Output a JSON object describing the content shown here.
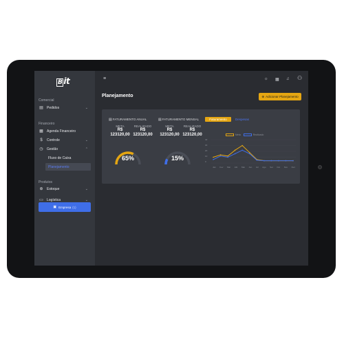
{
  "app": {
    "logo_text": "it",
    "logo_box": "B"
  },
  "sidebar": {
    "sections": [
      {
        "label": "Comercial"
      },
      {
        "label": "Financeiro"
      },
      {
        "label": "Produtos"
      }
    ],
    "items": [
      {
        "label": "Pedidos",
        "icon": "document-icon"
      },
      {
        "label": "Agenda Financeiro",
        "icon": "calendar-icon"
      },
      {
        "label": "Controle",
        "icon": "dollar-icon"
      },
      {
        "label": "Gestão",
        "icon": "clock-icon"
      },
      {
        "label": "Estoque",
        "icon": "globe-icon"
      },
      {
        "label": "Logística",
        "icon": "truck-icon"
      }
    ],
    "subitems": [
      {
        "label": "Fluxo de Caixa"
      },
      {
        "label": "Planejamento"
      }
    ],
    "company_button": {
      "label": "Empresa",
      "suffix": "(1)"
    }
  },
  "header": {
    "icons": [
      "sun-icon",
      "grid-icon",
      "notification-icon",
      "user-icon"
    ]
  },
  "page": {
    "title": "Planejamento",
    "add_button": "Adicionar Planejamento"
  },
  "kpis": [
    {
      "title": "FATURAMENTO ANUAL",
      "meta_label": "META",
      "realizado_label": "REALIZADO",
      "currency": "R$",
      "meta_value": "123120,00",
      "realizado_value": "123120,00"
    },
    {
      "title": "FATURAMENTO MENSAL",
      "meta_label": "META",
      "realizado_label": "REALIZADO",
      "currency": "R$",
      "meta_value": "123120,00",
      "realizado_value": "123120,00"
    }
  ],
  "gauges": [
    {
      "value_text": "65%",
      "value": 0.65,
      "color": "#e5a612"
    },
    {
      "value_text": "15%",
      "value": 0.15,
      "color": "#3f6ee8"
    }
  ],
  "tabs": [
    {
      "label": "Faturamento",
      "active": true
    },
    {
      "label": "Despesas",
      "active": false
    }
  ],
  "colors": {
    "accent": "#e5a612",
    "primary": "#3f6ee8",
    "sidebar": "#34373d",
    "background": "#2a2c31",
    "card": "#3a3d44"
  },
  "chart_data": {
    "type": "line",
    "legend": [
      "Meta",
      "Realizado"
    ],
    "categories": [
      "Jan",
      "Fev",
      "Mar",
      "Abr",
      "Mai",
      "Jun",
      "Jul",
      "Ago",
      "Set",
      "Out",
      "Nov",
      "Dez"
    ],
    "series": [
      {
        "name": "Meta",
        "color": "#e5a612",
        "values": [
          10,
          14,
          12,
          22,
          30,
          18,
          6,
          4,
          4,
          4,
          4,
          4
        ]
      },
      {
        "name": "Realizado",
        "color": "#3f6ee8",
        "values": [
          6,
          12,
          10,
          16,
          22,
          16,
          5,
          4,
          4,
          4,
          4,
          4
        ]
      }
    ],
    "ylim": [
      0,
      40
    ],
    "yticks": [
      "40",
      "30",
      "20",
      "10",
      "0"
    ]
  }
}
